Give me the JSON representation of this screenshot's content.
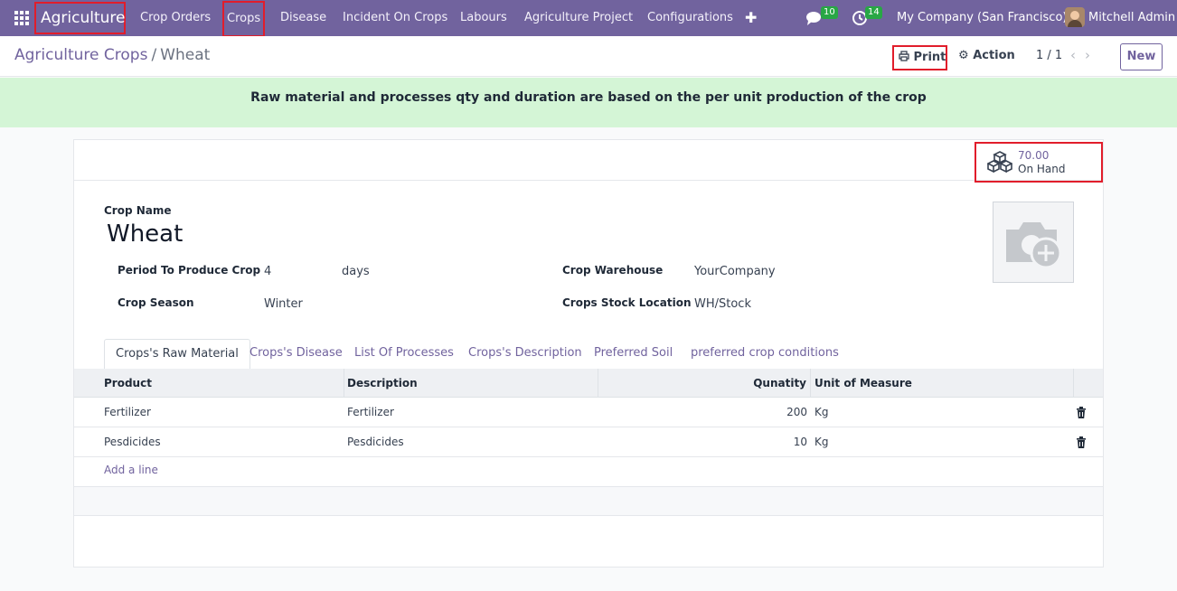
{
  "navbar": {
    "brand": "Agriculture",
    "menu": [
      "Crop Orders",
      "Crops",
      "Disease",
      "Incident On Crops",
      "Labours",
      "Agriculture Project",
      "Configurations"
    ],
    "messages_count": "10",
    "activities_count": "14",
    "company": "My Company (San Francisco)",
    "user": "Mitchell Admin"
  },
  "control_panel": {
    "breadcrumb_parent": "Agriculture Crops",
    "breadcrumb_separator": "/",
    "breadcrumb_current": "Wheat",
    "print_label": "Print",
    "action_label": "Action",
    "pager": "1 / 1",
    "new_label": "New"
  },
  "alert": {
    "text": "Raw material and processes qty and duration are based on the per unit production of the crop"
  },
  "stat_button": {
    "value": "70.00",
    "label": "On Hand"
  },
  "form": {
    "crop_name_label": "Crop Name",
    "crop_name": "Wheat",
    "period_label": "Period To Produce Crop",
    "period_value": "4",
    "period_unit": "days",
    "season_label": "Crop Season",
    "season_value": "Winter",
    "warehouse_label": "Crop Warehouse",
    "warehouse_value": "YourCompany",
    "stock_location_label": "Crops Stock Location",
    "stock_location_value": "WH/Stock"
  },
  "tabs": [
    "Crops's Raw Material",
    "Crops's Disease",
    "List Of Processes",
    "Crops's Description",
    "Preferred Soil",
    "preferred crop conditions"
  ],
  "table": {
    "headers": [
      "Product",
      "Description",
      "Qunatity",
      "Unit of Measure"
    ],
    "rows": [
      {
        "product": "Fertilizer",
        "description": "Fertilizer",
        "quantity": "200",
        "uom": "Kg"
      },
      {
        "product": "Pesdicides",
        "description": "Pesdicides",
        "quantity": "10",
        "uom": "Kg"
      }
    ],
    "add_line": "Add a line"
  },
  "colors": {
    "brand": "#71639e",
    "alert_bg": "#d4f5d6",
    "badge": "#28a745",
    "highlight": "#e11d2b"
  }
}
